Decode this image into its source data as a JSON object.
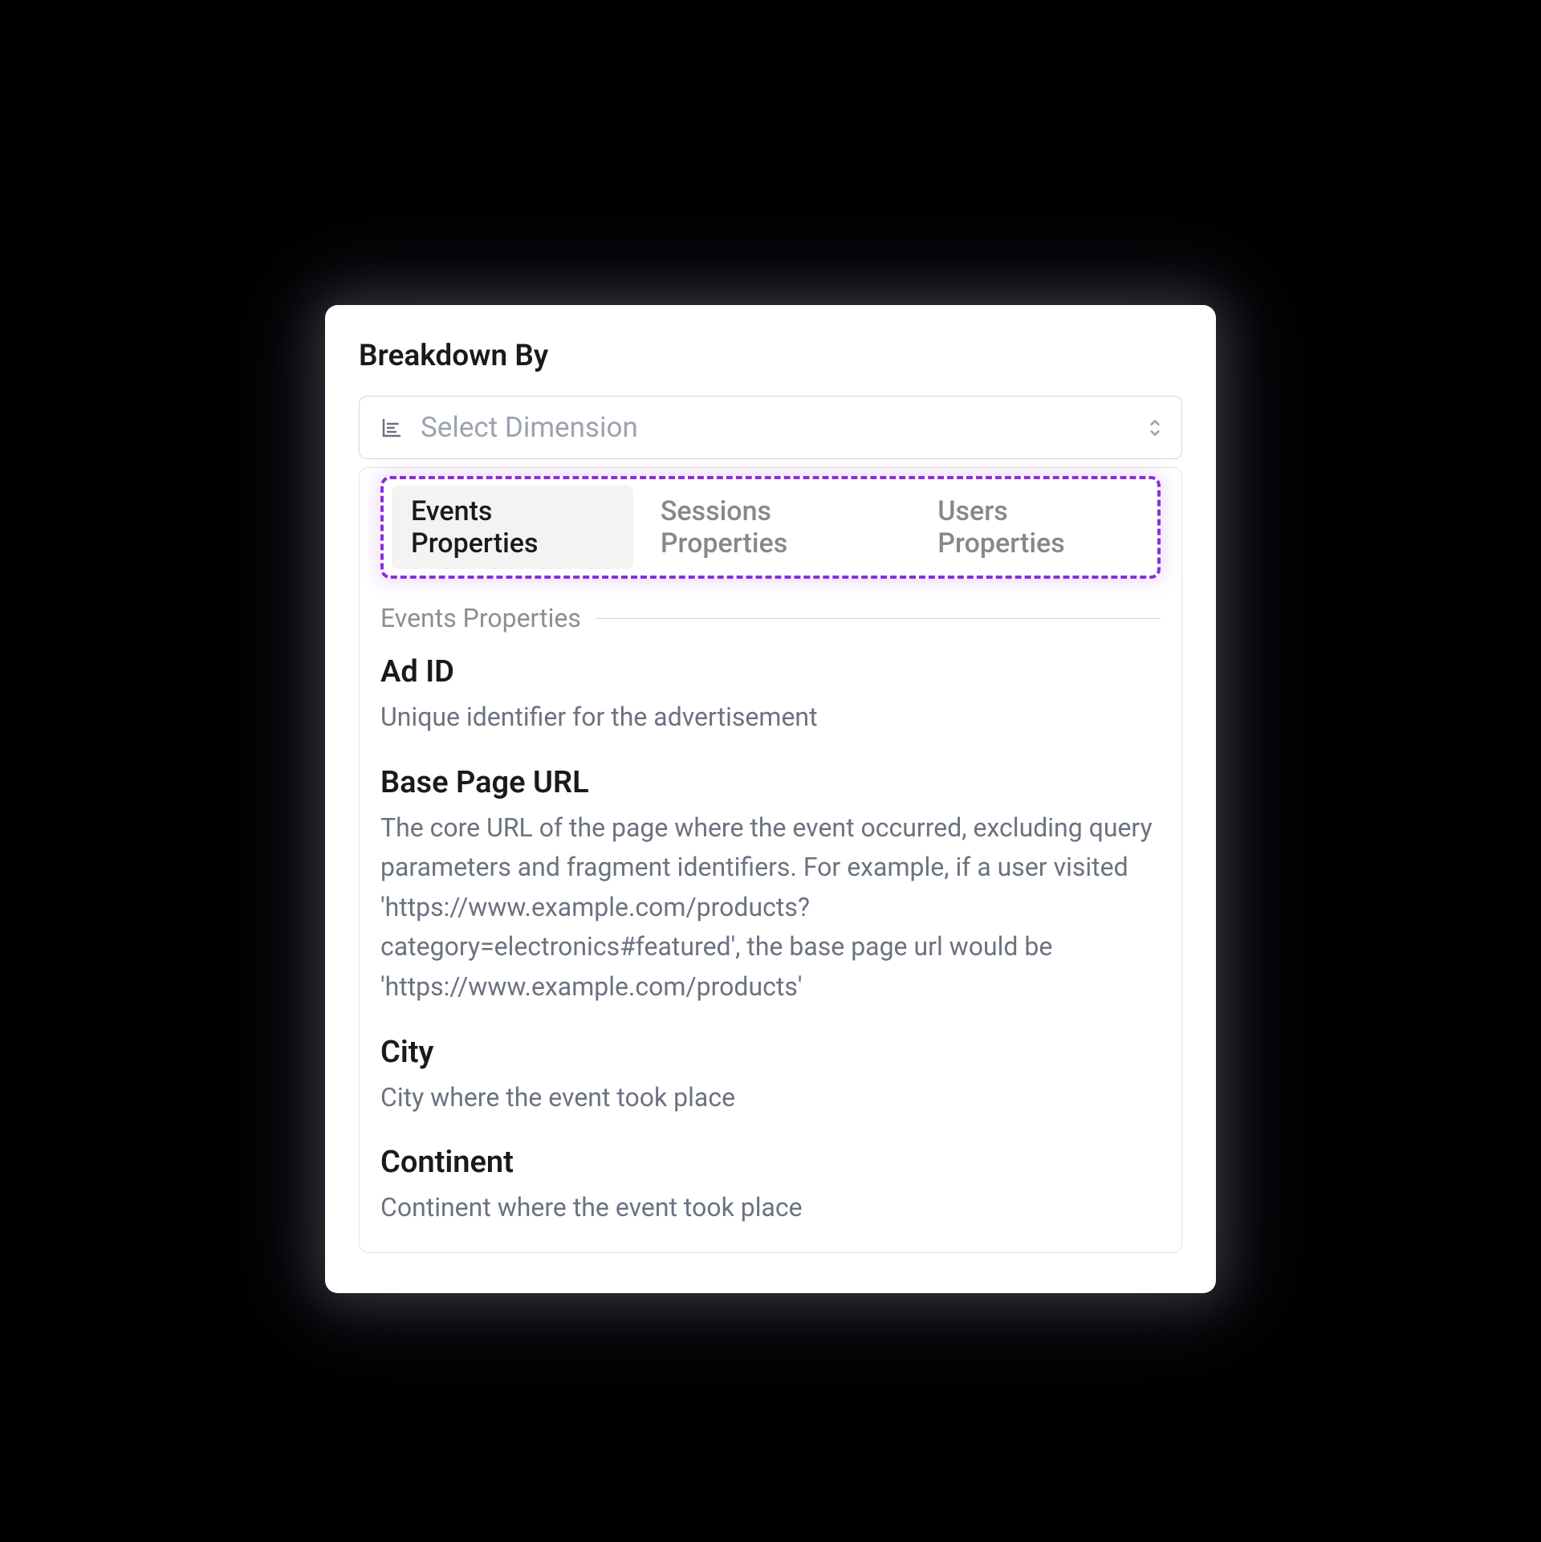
{
  "panel": {
    "title": "Breakdown By",
    "select": {
      "placeholder": "Select Dimension"
    },
    "tabs": [
      {
        "label": "Events Properties",
        "active": true
      },
      {
        "label": "Sessions Properties",
        "active": false
      },
      {
        "label": "Users Properties",
        "active": false
      }
    ],
    "section_label": "Events Properties",
    "properties": [
      {
        "title": "Ad ID",
        "description": "Unique identifier for the advertisement"
      },
      {
        "title": "Base Page URL",
        "description": "The core URL of the page where the event occurred, excluding query parameters and fragment identifiers. For example, if a user visited 'https://www.example.com/products?category=electronics#featured', the base page url would be 'https://www.example.com/products'"
      },
      {
        "title": "City",
        "description": "City where the event took place"
      },
      {
        "title": "Continent",
        "description": "Continent where the event took place"
      }
    ]
  }
}
